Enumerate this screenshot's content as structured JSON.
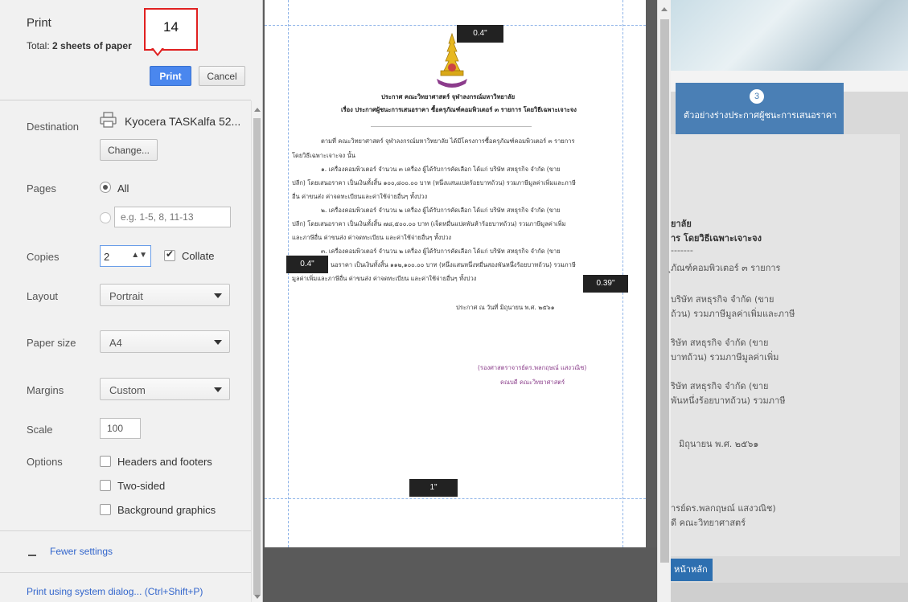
{
  "header": {
    "title": "Print",
    "total_label": "Total:",
    "total_value": "2 sheets of paper",
    "print_label": "Print",
    "cancel_label": "Cancel"
  },
  "callout": {
    "number": "14"
  },
  "destination": {
    "label": "Destination",
    "printer": "Kyocera TASKalfa 52...",
    "change_label": "Change..."
  },
  "pages": {
    "label": "Pages",
    "all_label": "All",
    "range_placeholder": "e.g. 1-5, 8, 11-13"
  },
  "copies": {
    "label": "Copies",
    "value": "2",
    "collate_label": "Collate",
    "collate_checked": true
  },
  "layout": {
    "label": "Layout",
    "value": "Portrait"
  },
  "paper_size": {
    "label": "Paper size",
    "value": "A4"
  },
  "margins": {
    "label": "Margins",
    "value": "Custom"
  },
  "scale": {
    "label": "Scale",
    "value": "100"
  },
  "options": {
    "label": "Options",
    "headers_footers": "Headers and footers",
    "two_sided": "Two-sided",
    "background_graphics": "Background graphics"
  },
  "fewer_settings": "Fewer settings",
  "system_dialog": "Print using system dialog... (Ctrl+Shift+P)",
  "preview": {
    "margin_top": "0.4\"",
    "margin_left": "0.4\"",
    "margin_right": "0.39\"",
    "margin_bottom": "1\"",
    "doc": {
      "title1": "ประกาศ คณะวิทยาศาสตร์ จุฬาลงกรณ์มหาวิทยาลัย",
      "title2": "เรื่อง ประกาศผู้ชนะการเสนอราคา ซื้อครุภัณฑ์คอมพิวเตอร์ ๓ รายการ โดยวิธีเฉพาะเจาะจง",
      "p1": "ตามที่ คณะวิทยาศาสตร์ จุฬาลงกรณ์มหาวิทยาลัย ได้มีโครงการซื้อครุภัณฑ์คอมพิวเตอร์ ๓ รายการ",
      "p1b": "โดยวิธีเฉพาะเจาะจง นั้น",
      "i1a": "๑. เครื่องคอมพิวเตอร์ จำนวน ๓ เครื่อง ผู้ได้รับการคัดเลือก ได้แก่ บริษัท สหธุรกิจ จำกัด (ขาย",
      "i1b": "ปลีก) โดยเสนอราคา เป็นเงินทั้งสิ้น ๑๐๐,๘๐๐.๐๐ บาท (หนึ่งแสนแปดร้อยบาทถ้วน) รวมภาษีมูลค่าเพิ่มและภาษี",
      "i1c": "อื่น ค่าขนส่ง ค่าจดทะเบียนและค่าใช้จ่ายอื่นๆ ทั้งปวง",
      "i2a": "๒. เครื่องคอมพิวเตอร์ จำนวน ๒ เครื่อง ผู้ได้รับการคัดเลือก ได้แก่ บริษัท สหธุรกิจ จำกัด (ขาย",
      "i2b": "ปลีก) โดยเสนอราคา เป็นเงินทั้งสิ้น ๗๘,๕๐๐.๐๐ บาท (เจ็ดหมื่นแปดพันห้าร้อยบาทถ้วน) รวมภาษีมูลค่าเพิ่ม",
      "i2c": "และภาษีอื่น ค่าขนส่ง ค่าจดทะเบียน และค่าใช้จ่ายอื่นๆ ทั้งปวง",
      "i3a": "๓. เครื่องคอมพิวเตอร์ จำนวน ๒ เครื่อง ผู้ได้รับการคัดเลือก ได้แก่ บริษัท สหธุรกิจ จำกัด (ขาย",
      "i3b": "นอราคา เป็นเงินทั้งสิ้น ๑๑๒,๑๐๐.๐๐ บาท (หนึ่งแสนหนึ่งหมื่นสองพันหนึ่งร้อยบาทถ้วน) รวมภาษี",
      "i3c": "มูลค่าเพิ่มและภาษีอื่น ค่าขนส่ง ค่าจดทะเบียน และค่าใช้จ่ายอื่นๆ ทั้งปวง",
      "date": "ประกาศ ณ วันที่     มิถุนายน พ.ศ. ๒๕๖๑",
      "signer": "(รองศาสตราจารย์ดร.พลกฤษณ์ แสงวณิช)",
      "position": "คณบดี คณะวิทยาศาสตร์"
    }
  },
  "background": {
    "step_number": "3",
    "step_label": "ตัวอย่างร่างประกาศผู้ชนะการเสนอราคา",
    "lines": [
      "ยาลัย",
      "าร โดยวิธีเฉพาะเจาะจง",
      "-------",
      "ุภัณฑ์คอมพิวเตอร์ ๓ รายการ",
      "บริษัท สหธุรกิจ จำกัด (ขาย",
      "ถ้วน) รวมภาษีมูลค่าเพิ่มและภาษี",
      "ริษัท สหธุรกิจ จำกัด (ขาย",
      "บาทถ้วน) รวมภาษีมูลค่าเพิ่ม",
      "ริษัท สหธุรกิจ จำกัด (ขาย",
      "พันหนึ่งร้อยบาทถ้วน) รวมภาษี",
      "มิถุนายน พ.ศ. ๒๕๖๑",
      "ารย์ดร.พลกฤษณ์ แสงวณิช)",
      "ดี คณะวิทยาศาสตร์"
    ],
    "home_button": "หน้าหลัก"
  },
  "colors": {
    "print_button": "#4a87ee",
    "link": "#3366cc",
    "callout_border": "#e02020",
    "step_bg": "#4a7fb5",
    "doc_highlight": "#8a3d8a"
  },
  "icons": {
    "printer": "printer-icon",
    "dropdown": "chevron-down-icon",
    "collapse": "minus-icon",
    "seal": "university-seal-icon"
  }
}
